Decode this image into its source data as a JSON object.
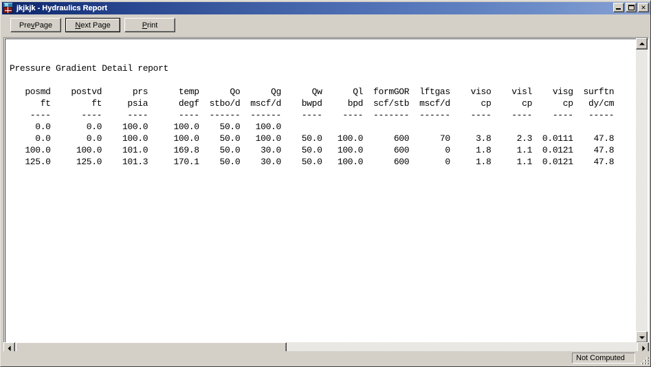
{
  "window": {
    "title": "jkjkjk - Hydraulics Report",
    "icon": "hydraulics-app-icon",
    "controls": [
      {
        "name": "minimize-button",
        "glyph": "minimize"
      },
      {
        "name": "maximize-button",
        "glyph": "maximize"
      },
      {
        "name": "close-button",
        "glyph": "✕"
      }
    ]
  },
  "toolbar": {
    "prev_page": {
      "pre": "Pre",
      "accel": "v",
      "post": " Page"
    },
    "next_page": {
      "pre": "",
      "accel": "N",
      "post": "ext Page"
    },
    "print": {
      "pre": "",
      "accel": "P",
      "post": "rint"
    }
  },
  "report": {
    "title": "Pressure Gradient Detail report",
    "columns": [
      {
        "name": "posmd",
        "unit": "ft"
      },
      {
        "name": "postvd",
        "unit": "ft"
      },
      {
        "name": "prs",
        "unit": "psia"
      },
      {
        "name": "temp",
        "unit": "degf"
      },
      {
        "name": "Qo",
        "unit": "stbo/d"
      },
      {
        "name": "Qg",
        "unit": "mscf/d"
      },
      {
        "name": "Qw",
        "unit": "bwpd"
      },
      {
        "name": "Ql",
        "unit": "bpd"
      },
      {
        "name": "formGOR",
        "unit": "scf/stb"
      },
      {
        "name": "lftgas",
        "unit": "mscf/d"
      },
      {
        "name": "viso",
        "unit": "cp"
      },
      {
        "name": "visl",
        "unit": "cp"
      },
      {
        "name": "visg",
        "unit": "cp"
      },
      {
        "name": "surftn",
        "unit": "dy/cm"
      }
    ],
    "rows": [
      [
        "0.0",
        "0.0",
        "100.0",
        "100.0",
        "50.0",
        "100.0",
        "",
        "",
        "",
        "",
        "",
        "",
        "",
        ""
      ],
      [
        "0.0",
        "0.0",
        "100.0",
        "100.0",
        "50.0",
        "100.0",
        "50.0",
        "100.0",
        "600",
        "70",
        "3.8",
        "2.3",
        "0.0111",
        "47.8"
      ],
      [
        "100.0",
        "100.0",
        "101.0",
        "169.8",
        "50.0",
        "30.0",
        "50.0",
        "100.0",
        "600",
        "0",
        "1.8",
        "1.1",
        "0.0121",
        "47.8"
      ],
      [
        "125.0",
        "125.0",
        "101.3",
        "170.1",
        "50.0",
        "30.0",
        "50.0",
        "100.0",
        "600",
        "0",
        "1.8",
        "1.1",
        "0.0121",
        "47.8"
      ]
    ],
    "text": "Pressure Gradient Detail report\n\n   posmd    postvd      prs      temp      Qo      Qg      Qw      Ql  formGOR  lftgas    viso    visl    visg  surftn\n      ft        ft     psia      degf  stbo/d  mscf/d    bwpd     bpd  scf/stb  mscf/d      cp      cp      cp   dy/cm\n    ----      ----     ----      ----  ------  ------    ----    ----  -------  ------    ----    ----    ----   -----\n     0.0       0.0    100.0     100.0    50.0   100.0\n     0.0       0.0    100.0     100.0    50.0   100.0    50.0   100.0      600      70     3.8     2.3  0.0111    47.8\n   100.0     100.0    101.0     169.8    50.0    30.0    50.0   100.0      600       0     1.8     1.1  0.0121    47.8\n   125.0     125.0    101.3     170.1    50.0    30.0    50.0   100.0      600       0     1.8     1.1  0.0121    47.8"
  },
  "status": {
    "message": "Not Computed"
  },
  "colors": {
    "face": "#d4d0c8",
    "title_start": "#0a246a",
    "title_end": "#8aa2d4",
    "client": "#ffffff",
    "text": "#000000"
  }
}
